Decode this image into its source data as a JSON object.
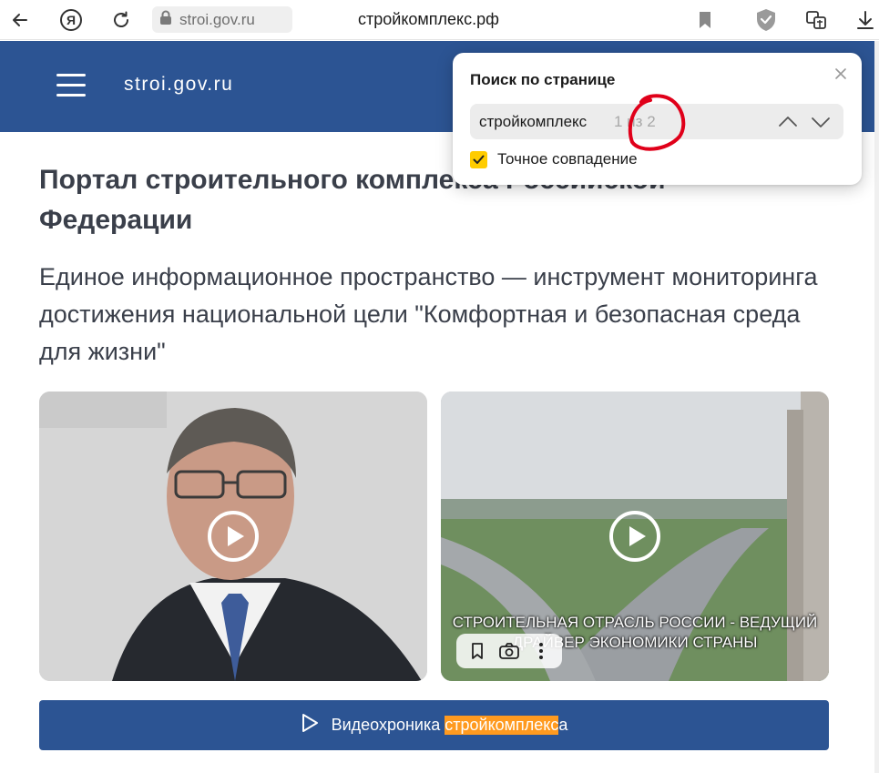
{
  "browser": {
    "domain": "stroi.gov.ru",
    "page_title": "стройкомплекс.рф",
    "icons": [
      "back-icon",
      "yandex-icon",
      "reload-icon",
      "lock-icon",
      "bookmark-icon",
      "shield-icon",
      "translate-icon",
      "download-icon"
    ]
  },
  "header": {
    "logo": "stroi.gov.ru",
    "menu_icon": "hamburger-icon"
  },
  "main": {
    "heading": "Портал строительного комплекса Российской Федерации",
    "subheading": "Единое информационное пространство — инструмент мониторинга достижения национальной цели \"Комфортная и безопасная среда для жизни\"",
    "videos": [
      {
        "caption": ""
      },
      {
        "caption": "СТРОИТЕЛЬНАЯ ОТРАСЛЬ РОССИИ - ВЕДУЩИЙ ДРАЙВЕР ЭКОНОМИКИ СТРАНЫ"
      }
    ],
    "chronicle_button": {
      "prefix": "Видеохроника ",
      "highlight": "стройкомплекс",
      "suffix": "а"
    }
  },
  "find_popup": {
    "title": "Поиск по странице",
    "query": "стройкомплекс",
    "match_count": "1 из 2",
    "exact_match_label": "Точное совпадение",
    "exact_match_checked": true,
    "checkbox_color": "#ffcc00"
  },
  "colors": {
    "brand_blue": "#2c5493",
    "highlight_orange": "#ff9a1f",
    "annotation_red": "#e0001a"
  }
}
